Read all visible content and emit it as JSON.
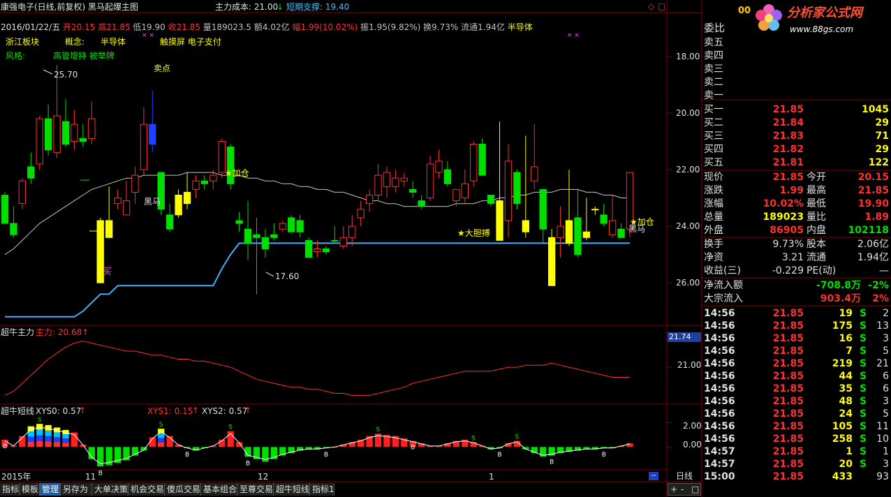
{
  "header": {
    "title": "康强电子(日线,前复权) 黑马起爆主图",
    "cost_label": "主力成本: 21.00",
    "cost_arrow": "↓",
    "support_label": "短期支撑: 19.40"
  },
  "quote_line": {
    "date": "2016/01/22/五",
    "open": "开20.15",
    "high": "高21.85",
    "low": "低19.90",
    "close": "收21.85",
    "volume": "量189023.5",
    "amount": "额4.02亿",
    "change": "幅1.99(10.02%)",
    "amplitude": "振1.95(9.82%)",
    "turnover": "换9.73%",
    "float": "流通1.94亿",
    "sector": "半导体"
  },
  "info": {
    "region": "浙江板块",
    "concept_label": "概念:",
    "concept1": "半导体",
    "concept2": "触摸屏 电子支付",
    "style_label": "风格:",
    "style_value": "高管增持 被举牌"
  },
  "annotations": {
    "high_price": "25.70",
    "low_price": "17.60",
    "sell_point": "卖点",
    "add_pos_1": "★加仓",
    "dark_horse_1": "黑马",
    "buy_mark": "买",
    "bold_buy": "★大胆搏",
    "add_pos_2": "★加仓",
    "dark_horse_2": "黑马",
    "x_marks": "× ×"
  },
  "price_axis": [
    "26.00",
    "24.00",
    "22.00",
    "20.00",
    "18.00"
  ],
  "chart_data": [
    {
      "type": "candlestick",
      "title": "黑马起爆主图",
      "ylim": [
        16.5,
        27.5
      ],
      "yticks": [
        18,
        20,
        22,
        24,
        26
      ],
      "candles": [
        [
          21.1,
          21.2,
          20.1,
          20.1,
          "g"
        ],
        [
          20.1,
          20.7,
          19.6,
          19.7,
          "g"
        ],
        [
          20.8,
          21.7,
          20.6,
          21.6,
          "r"
        ],
        [
          21.7,
          22.6,
          21.5,
          22.1,
          "g"
        ],
        [
          22.2,
          23.9,
          22.0,
          23.8,
          "r"
        ],
        [
          23.8,
          24.3,
          22.5,
          22.7,
          "g"
        ],
        [
          22.6,
          25.7,
          22.4,
          23.9,
          "r"
        ],
        [
          23.7,
          24.5,
          22.8,
          22.9,
          "g"
        ],
        [
          23.0,
          24.1,
          22.7,
          23.6,
          "r"
        ],
        [
          23.1,
          23.6,
          22.8,
          23.0,
          "g"
        ],
        [
          23.1,
          24.4,
          22.9,
          23.8,
          "r"
        ],
        [
          20.2,
          20.3,
          18.0,
          18.0,
          "y"
        ],
        [
          20.2,
          21.4,
          19.6,
          19.6,
          "y"
        ],
        [
          20.8,
          21.3,
          20.6,
          21.0,
          "r"
        ],
        [
          20.9,
          21.6,
          20.4,
          20.4,
          "r"
        ],
        [
          21.2,
          22.1,
          20.8,
          21.8,
          "r"
        ],
        [
          22.0,
          24.2,
          21.8,
          23.6,
          "r"
        ],
        [
          23.6,
          24.8,
          22.6,
          22.9,
          "b"
        ],
        [
          21.9,
          21.9,
          20.4,
          20.6,
          "g"
        ],
        [
          20.4,
          20.8,
          19.8,
          19.9,
          "g"
        ],
        [
          20.4,
          21.3,
          20.3,
          21.1,
          "y"
        ],
        [
          20.8,
          21.9,
          20.6,
          21.2,
          "y"
        ],
        [
          21.3,
          21.8,
          21.0,
          21.6,
          "r"
        ],
        [
          21.6,
          21.8,
          21.3,
          21.5,
          "g"
        ],
        [
          21.6,
          22.0,
          21.3,
          21.8,
          "r"
        ],
        [
          21.9,
          23.1,
          21.7,
          23.0,
          "r"
        ],
        [
          22.8,
          22.9,
          21.3,
          21.5,
          "g"
        ],
        [
          20.2,
          20.5,
          19.8,
          20.1,
          "g"
        ],
        [
          19.9,
          20.9,
          18.8,
          19.4,
          "g"
        ],
        [
          19.6,
          20.3,
          17.6,
          19.7,
          "g"
        ],
        [
          19.2,
          19.9,
          18.9,
          19.6,
          "g"
        ],
        [
          19.6,
          20.1,
          19.5,
          19.7,
          "g"
        ],
        [
          20.1,
          20.2,
          19.8,
          19.9,
          "r"
        ],
        [
          20.3,
          20.4,
          19.8,
          19.8,
          "g"
        ],
        [
          20.2,
          20.4,
          19.6,
          19.8,
          "g"
        ],
        [
          19.5,
          19.6,
          18.9,
          18.9,
          "g"
        ],
        [
          19.1,
          19.5,
          18.9,
          19.2,
          "r"
        ],
        [
          19.1,
          19.3,
          19.0,
          19.2,
          "g"
        ],
        [
          19.5,
          20.0,
          19.4,
          19.5,
          "g"
        ],
        [
          19.6,
          20.0,
          19.2,
          19.3,
          "r"
        ],
        [
          19.6,
          20.4,
          19.3,
          20.0,
          "r"
        ],
        [
          20.3,
          20.9,
          20.0,
          20.6,
          "r"
        ],
        [
          20.8,
          21.3,
          20.5,
          21.1,
          "r"
        ],
        [
          21.1,
          22.2,
          20.9,
          21.8,
          "r"
        ],
        [
          21.4,
          22.1,
          21.0,
          21.9,
          "r"
        ],
        [
          21.4,
          22.0,
          21.2,
          21.7,
          "r"
        ],
        [
          21.6,
          21.9,
          21.4,
          21.7,
          "r"
        ],
        [
          21.3,
          21.6,
          21.0,
          21.2,
          "g"
        ],
        [
          20.9,
          21.1,
          20.6,
          20.7,
          "g"
        ],
        [
          21.0,
          22.5,
          20.9,
          22.2,
          "r"
        ],
        [
          21.9,
          22.7,
          21.7,
          22.3,
          "r"
        ],
        [
          22.0,
          22.3,
          21.4,
          21.5,
          "g"
        ],
        [
          20.9,
          21.1,
          20.7,
          21.3,
          "r"
        ],
        [
          21.0,
          22.0,
          20.8,
          21.5,
          "r"
        ],
        [
          21.6,
          23.0,
          21.4,
          22.9,
          "r"
        ],
        [
          22.9,
          23.1,
          21.8,
          21.8,
          "g"
        ],
        [
          20.8,
          21.0,
          20.7,
          21.1,
          "g"
        ],
        [
          19.5,
          23.7,
          19.5,
          20.9,
          "y"
        ],
        [
          20.2,
          22.9,
          19.6,
          22.3,
          "r"
        ],
        [
          21.9,
          22.0,
          20.6,
          20.8,
          "g"
        ],
        [
          19.8,
          23.2,
          19.6,
          20.2,
          "y"
        ],
        [
          21.6,
          23.6,
          21.3,
          22.1,
          "r"
        ],
        [
          21.3,
          21.3,
          19.4,
          19.9,
          "g"
        ],
        [
          19.6,
          19.9,
          17.9,
          17.9,
          "y"
        ],
        [
          19.6,
          20.7,
          18.9,
          20.0,
          "r"
        ],
        [
          19.4,
          22.0,
          19.3,
          20.2,
          "y"
        ],
        [
          19.0,
          21.3,
          18.9,
          20.3,
          "g"
        ],
        [
          19.6,
          21.0,
          19.5,
          19.8,
          "y"
        ],
        [
          20.6,
          20.7,
          20.4,
          20.6,
          "y"
        ],
        [
          20.4,
          20.8,
          20.0,
          20.1,
          "g"
        ],
        [
          20.2,
          21.1,
          19.6,
          19.7,
          "r"
        ],
        [
          19.9,
          20.1,
          19.6,
          19.6,
          "g"
        ],
        [
          19.9,
          21.9,
          19.6,
          21.9,
          "r"
        ]
      ],
      "series": [
        {
          "name": "",
          "color": "#c8c8c8",
          "values": [
            19.0,
            19.2,
            19.5,
            19.8,
            20.1,
            20.3,
            20.5,
            20.7,
            20.9,
            21.1,
            21.3,
            21.4,
            21.5,
            21.6,
            21.7,
            21.7,
            21.8,
            21.8,
            21.8,
            21.8,
            21.8,
            21.9,
            21.9,
            21.9,
            21.9,
            21.8,
            21.8,
            21.8,
            21.7,
            21.7,
            21.6,
            21.6,
            21.5,
            21.5,
            21.4,
            21.4,
            21.3,
            21.3,
            21.2,
            21.2,
            21.1,
            21.0,
            20.9,
            20.9,
            20.8,
            20.8,
            20.7,
            20.7,
            20.7,
            20.7,
            20.7,
            20.7,
            20.8,
            20.8,
            20.8,
            20.9,
            20.9,
            21.0,
            21.0,
            21.1,
            21.1,
            21.2,
            21.2,
            21.2,
            21.3,
            21.3,
            21.3,
            21.2,
            21.2,
            21.1,
            21.1,
            21.0,
            21.0
          ]
        },
        {
          "name": "短期支撑",
          "color": "#40b0ff",
          "values": [
            16.8,
            16.8,
            16.8,
            16.8,
            16.8,
            16.8,
            16.8,
            16.8,
            16.8,
            17.0,
            17.3,
            17.6,
            17.6,
            17.9,
            17.9,
            17.9,
            17.9,
            17.9,
            17.9,
            17.9,
            17.9,
            17.9,
            17.9,
            17.9,
            17.9,
            18.5,
            19.0,
            19.4,
            19.4,
            19.4,
            19.4,
            19.4,
            19.4,
            19.4,
            19.4,
            19.4,
            19.4,
            19.4,
            19.4,
            19.4,
            19.4,
            19.4,
            19.4,
            19.4,
            19.4,
            19.4,
            19.4,
            19.4,
            19.4,
            19.4,
            19.4,
            19.4,
            19.4,
            19.4,
            19.4,
            19.4,
            19.4,
            19.4,
            19.4,
            19.4,
            19.4,
            19.4,
            19.4,
            19.4,
            19.4,
            19.4,
            19.4,
            19.4,
            19.4,
            19.4,
            19.4,
            19.4,
            19.4
          ]
        }
      ]
    },
    {
      "type": "line",
      "title": "超牛主力",
      "ylim": [
        19.3,
        22.6
      ],
      "yticks": [
        21.0
      ],
      "current_label": "21.74",
      "series": [
        {
          "name": "主力",
          "color": "#ff3030",
          "values": [
            19.6,
            19.8,
            20.2,
            20.6,
            21.0,
            21.4,
            21.7,
            22.0,
            22.2,
            22.3,
            22.2,
            22.1,
            22.0,
            21.9,
            21.8,
            21.8,
            21.7,
            21.6,
            21.6,
            21.5,
            21.4,
            21.4,
            21.3,
            21.3,
            21.2,
            21.1,
            21.0,
            20.8,
            20.6,
            20.4,
            20.3,
            20.2,
            20.1,
            20.0,
            20.0,
            19.9,
            19.9,
            19.8,
            19.7,
            19.7,
            19.6,
            19.6,
            19.6,
            19.7,
            19.8,
            19.9,
            20.0,
            20.2,
            20.3,
            20.4,
            20.5,
            20.6,
            20.7,
            20.8,
            20.8,
            20.8,
            20.8,
            20.9,
            21.0,
            21.0,
            21.1,
            21.1,
            21.1,
            21.2,
            21.1,
            21.0,
            20.9,
            20.8,
            20.7,
            20.6,
            20.5,
            20.5,
            20.5
          ]
        }
      ]
    },
    {
      "type": "bar",
      "title": "超牛短线",
      "ylim": [
        -1.7,
        2.6
      ],
      "yticks": [
        2.0,
        0.0
      ],
      "values": [
        0.6,
        0.1,
        0.9,
        1.7,
        1.9,
        1.8,
        1.6,
        1.4,
        1.2,
        0.2,
        -1.0,
        -1.6,
        -1.5,
        -1.3,
        -1.1,
        -0.7,
        -0.3,
        0.8,
        1.5,
        0.9,
        0.2,
        -0.1,
        -0.3,
        -0.1,
        0.1,
        0.6,
        1.3,
        0.4,
        -0.8,
        -1.0,
        -1.2,
        -1.0,
        -0.7,
        -0.5,
        -0.3,
        -0.2,
        -0.2,
        -0.1,
        0.0,
        0.2,
        0.4,
        0.6,
        0.9,
        1.1,
        1.0,
        0.9,
        0.7,
        0.5,
        0.3,
        0.1,
        0.1,
        0.3,
        0.5,
        0.6,
        0.4,
        0.1,
        -0.2,
        -0.1,
        0.3,
        0.5,
        -0.2,
        -0.5,
        -0.8,
        -0.7,
        -0.5,
        -0.4,
        -0.3,
        -0.2,
        -0.2,
        -0.1,
        -0.1,
        0.1,
        0.3
      ],
      "xys0_label": "XYS0: 0.57",
      "xys1_label": "XYS1: 0.15",
      "xys2_label": "XYS2: 0.57"
    }
  ],
  "time_axis": [
    "2015年",
    "11",
    "12",
    "1"
  ],
  "right_panel": {
    "logo_main": "分析家公式网",
    "logo_url": "www.88gs.com",
    "code_fragment": "00",
    "ratio_label": "委比",
    "sell": [
      {
        "label": "卖五",
        "price": "",
        "vol": ""
      },
      {
        "label": "卖四",
        "price": "",
        "vol": ""
      },
      {
        "label": "卖三",
        "price": "",
        "vol": ""
      },
      {
        "label": "卖二",
        "price": "",
        "vol": ""
      },
      {
        "label": "卖一",
        "price": "",
        "vol": ""
      }
    ],
    "buy": [
      {
        "label": "买一",
        "price": "21.85",
        "vol": "1045"
      },
      {
        "label": "买二",
        "price": "21.84",
        "vol": "29"
      },
      {
        "label": "买三",
        "price": "21.83",
        "vol": "71"
      },
      {
        "label": "买四",
        "price": "21.82",
        "vol": "29"
      },
      {
        "label": "买五",
        "price": "21.81",
        "vol": "122"
      }
    ],
    "stats": [
      {
        "l1": "现价",
        "v1": "21.85",
        "c1": "red",
        "l2": "今开",
        "v2": "20.15",
        "c2": "red"
      },
      {
        "l1": "涨跌",
        "v1": "1.99",
        "c1": "red",
        "l2": "最高",
        "v2": "21.85",
        "c2": "red"
      },
      {
        "l1": "涨幅",
        "v1": "10.02%",
        "c1": "red",
        "l2": "最低",
        "v2": "19.90",
        "c2": "red"
      },
      {
        "l1": "总量",
        "v1": "189023",
        "c1": "yel",
        "l2": "量比",
        "v2": "1.89",
        "c2": "red"
      },
      {
        "l1": "外盘",
        "v1": "86905",
        "c1": "red",
        "l2": "内盘",
        "v2": "102118",
        "c2": "grn"
      }
    ],
    "stats2": [
      {
        "l1": "换手",
        "v1": "9.73%",
        "l2": "股本",
        "v2": "2.06亿"
      },
      {
        "l1": "净资",
        "v1": "3.21",
        "l2": "流通",
        "v2": "1.94亿"
      },
      {
        "l1": "收益(三)",
        "v1": "-0.229",
        "l2": "PE(动)",
        "v2": "—"
      }
    ],
    "flows": [
      {
        "label": "净流入额",
        "value": "-708.8万",
        "pct": "-2%",
        "color": "grn"
      },
      {
        "label": "大宗流入",
        "value": "903.4万",
        "pct": "2%",
        "color": "red"
      }
    ],
    "ticks": [
      [
        "14:56",
        "21.85",
        "19",
        "S",
        "2"
      ],
      [
        "14:56",
        "21.85",
        "175",
        "S",
        "13"
      ],
      [
        "14:56",
        "21.85",
        "16",
        "S",
        "3"
      ],
      [
        "14:56",
        "21.85",
        "7",
        "S",
        "5"
      ],
      [
        "14:56",
        "21.85",
        "219",
        "S",
        "21"
      ],
      [
        "14:56",
        "21.85",
        "44",
        "S",
        "6"
      ],
      [
        "14:56",
        "21.85",
        "35",
        "S",
        "6"
      ],
      [
        "14:56",
        "21.85",
        "48",
        "S",
        "3"
      ],
      [
        "14:56",
        "21.85",
        "24",
        "S",
        "5"
      ],
      [
        "14:56",
        "21.85",
        "105",
        "S",
        "11"
      ],
      [
        "14:56",
        "21.85",
        "258",
        "S",
        "10"
      ],
      [
        "14:57",
        "21.85",
        "1",
        "S",
        "1"
      ],
      [
        "14:57",
        "21.85",
        "20",
        "S",
        "3"
      ],
      [
        "15:00",
        "21.85",
        "433",
        "",
        "93"
      ]
    ]
  },
  "bottom_tabs": [
    "指标",
    "模板",
    "管理",
    "另存为",
    "大单决策",
    "机会交易",
    "傻瓜交易",
    "基本组合",
    "至尊交易",
    "超牛短线",
    "指标1"
  ],
  "bottom_right": {
    "period": "日线",
    "plus": "+",
    "minus": "-",
    "dots": "--",
    "zoom": "□"
  }
}
